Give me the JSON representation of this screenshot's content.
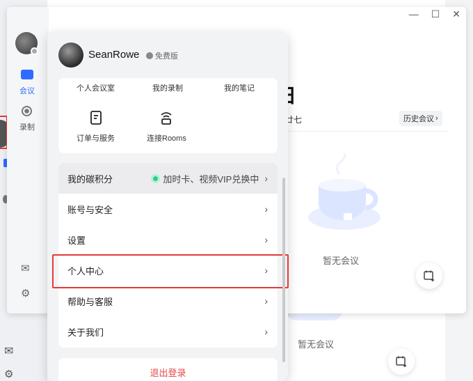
{
  "window": {
    "controls": [
      "—",
      "☐",
      "✕"
    ]
  },
  "sidebar": {
    "meeting_label": "会议",
    "recording_label": "录制"
  },
  "main": {
    "heading_fragment": "日",
    "date_fragment": "廿七",
    "history_button": "历史会议",
    "empty_text": "暂无会议"
  },
  "background_window": {
    "empty_text": "暂无会议"
  },
  "profile": {
    "username": "SeanRowe",
    "plan_badge": "免费版"
  },
  "quick_actions": {
    "top_row": [
      "个人会议室",
      "我的录制",
      "我的笔记"
    ],
    "items": [
      {
        "label": "订单与服务",
        "icon": "order-icon"
      },
      {
        "label": "连接Rooms",
        "icon": "rooms-icon"
      }
    ]
  },
  "menu_items": [
    {
      "label": "我的碳积分",
      "extra": "加时卡、视频VIP兑换中",
      "highlighted": true
    },
    {
      "label": "账号与安全"
    },
    {
      "label": "设置"
    },
    {
      "label": "个人中心",
      "boxed": true
    },
    {
      "label": "帮助与客服"
    },
    {
      "label": "关于我们"
    }
  ],
  "logout_label": "退出登录",
  "colors": {
    "accent": "#2f6bff",
    "danger": "#e5484d",
    "highlight_box": "#e53935",
    "green_badge": "#2ccf8a"
  }
}
